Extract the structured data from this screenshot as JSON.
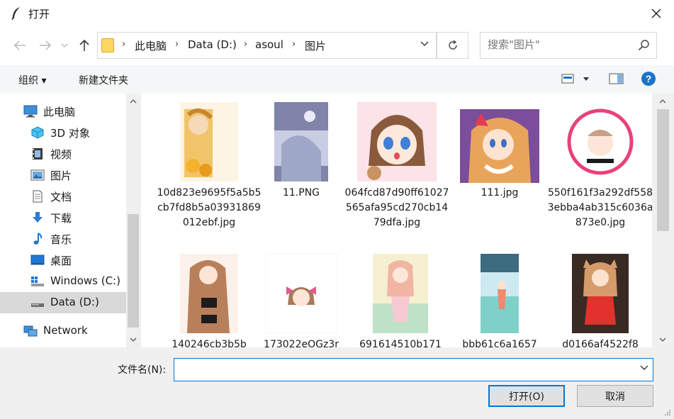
{
  "window": {
    "title": "打开"
  },
  "address": {
    "crumbs": [
      "此电脑",
      "Data (D:)",
      "asoul",
      "图片"
    ]
  },
  "search": {
    "placeholder": "搜索\"图片\""
  },
  "toolbar": {
    "organize": "组织 ▾",
    "new_folder": "新建文件夹"
  },
  "sidebar": {
    "items": [
      {
        "label": "此电脑",
        "icon": "computer-icon"
      },
      {
        "label": "3D 对象",
        "icon": "3d-objects-icon"
      },
      {
        "label": "视频",
        "icon": "video-icon"
      },
      {
        "label": "图片",
        "icon": "pictures-icon"
      },
      {
        "label": "文档",
        "icon": "documents-icon"
      },
      {
        "label": "下载",
        "icon": "download-icon"
      },
      {
        "label": "音乐",
        "icon": "music-icon"
      },
      {
        "label": "桌面",
        "icon": "desktop-icon"
      },
      {
        "label": "Windows (C:)",
        "icon": "drive-c-icon"
      },
      {
        "label": "Data (D:)",
        "icon": "drive-d-icon",
        "selected": true
      },
      {
        "label": "Network",
        "icon": "network-icon"
      }
    ]
  },
  "files": [
    {
      "name": "10d823e9695f5a5b5cb7fd8b5a03931869012ebf.jpg"
    },
    {
      "name": "11.PNG"
    },
    {
      "name": "064fcd87d90ff61027565afa95cd270cb1479dfa.jpg"
    },
    {
      "name": "111.jpg"
    },
    {
      "name": "550f161f3a292df5583ebba4ab315c6036a873e0.jpg"
    },
    {
      "name": "140246cb3b5b"
    },
    {
      "name": "173022eOGz3r"
    },
    {
      "name": "691614510b171"
    },
    {
      "name": "bbb61c6a1657"
    },
    {
      "name": "d0166af4522f8"
    }
  ],
  "bottom": {
    "filename_label": "文件名(N):",
    "filename_value": "",
    "open_label": "打开(O)",
    "cancel_label": "取消"
  },
  "colors": {
    "accent": "#0078d7",
    "selected": "#d9d9d9",
    "help": "#1a73c8"
  }
}
